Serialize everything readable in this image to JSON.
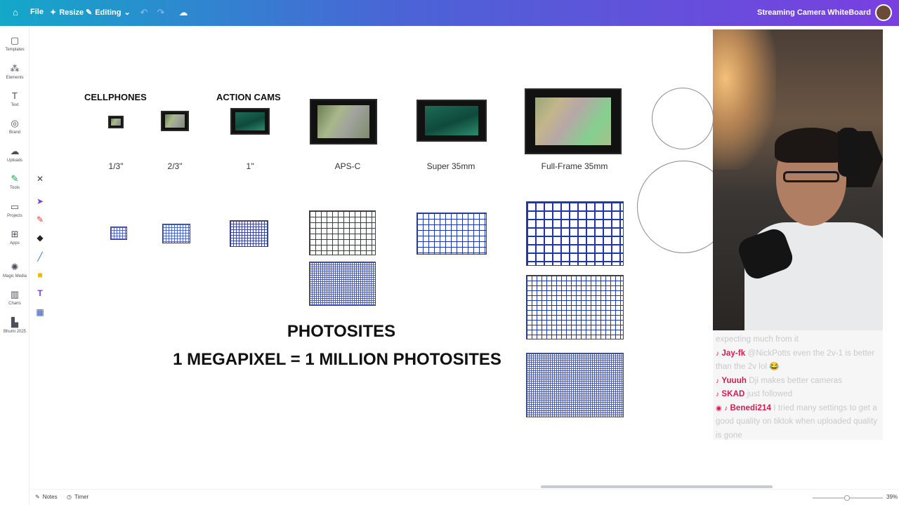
{
  "topbar": {
    "file_label": "File",
    "resize_label": "Resize",
    "mode_label": "Editing",
    "doc_title": "Streaming Camera WhiteBoard"
  },
  "sidebar": {
    "items": [
      {
        "label": "Templates",
        "icon": "templates-icon"
      },
      {
        "label": "Elements",
        "icon": "elements-icon"
      },
      {
        "label": "Text",
        "icon": "text-icon"
      },
      {
        "label": "Brand",
        "icon": "brand-icon"
      },
      {
        "label": "Uploads",
        "icon": "uploads-icon"
      },
      {
        "label": "Tools",
        "icon": "tools-icon"
      },
      {
        "label": "Projects",
        "icon": "projects-icon"
      },
      {
        "label": "Apps",
        "icon": "apps-icon"
      },
      {
        "label": "Magic Media",
        "icon": "magic-media-icon"
      },
      {
        "label": "Charts",
        "icon": "charts-icon"
      },
      {
        "label": "Bhumi 2025",
        "icon": "bhumi-icon"
      }
    ]
  },
  "toolpanel": {
    "tools": [
      "close-icon",
      "select-arrow-icon",
      "pen-icon",
      "eraser-icon",
      "line-icon",
      "sticky-note-icon",
      "text-tool-icon",
      "table-icon"
    ]
  },
  "canvas": {
    "heading_cellphones": "CELLPHONES",
    "heading_action_cams": "ACTION CAMS",
    "sensor_labels": [
      "1/3\"",
      "2/3\"",
      "1\"",
      "APS-C",
      "Super 35mm",
      "Full-Frame 35mm"
    ],
    "title_photosites": "PHOTOSITES",
    "title_megapixel": "1 MEGAPIXEL = 1 MILLION PHOTOSITES"
  },
  "chat": {
    "lines": [
      {
        "user": "",
        "text": "expecting much from it"
      },
      {
        "user": "Jay-fk",
        "text": "@NickPotts even the 2v-1 is better than the 2v lol 😂"
      },
      {
        "user": "Yuuuh",
        "text": "Dji makes better cameras"
      },
      {
        "user": "SKAD",
        "text": "just followed"
      },
      {
        "user": "Benedi214",
        "text": "I tried many settings to get a good quality on tiktok when uploaded quality is gone"
      }
    ]
  },
  "bottombar": {
    "notes_label": "Notes",
    "timer_label": "Timer",
    "zoom_label": "39%"
  },
  "colors": {
    "topbar_gradient_start": "#14a8c9",
    "topbar_gradient_end": "#7a3fe0",
    "grid_blue": "#1f35a8",
    "chat_username": "#d6184e"
  }
}
